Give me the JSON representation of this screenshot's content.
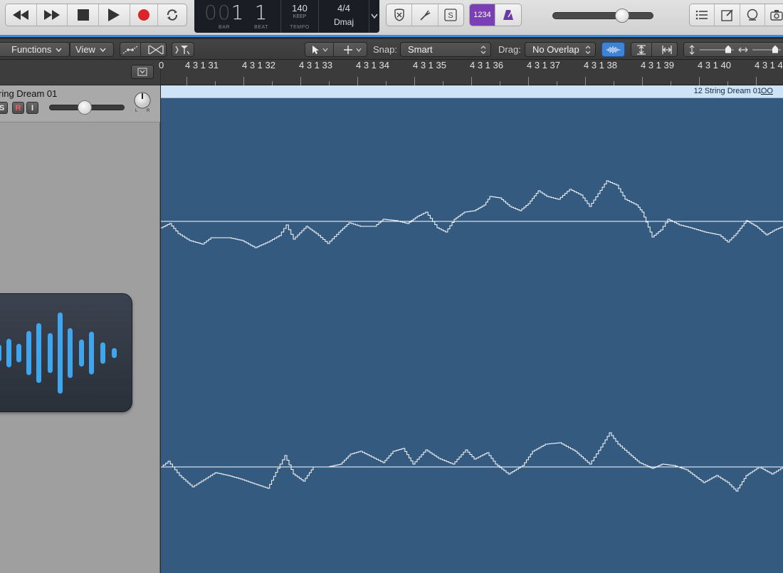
{
  "lcd": {
    "bar_dim": "00",
    "bar": "1",
    "beat": "1",
    "bar_label": "BAR",
    "beat_label": "BEAT",
    "tempo": "140",
    "tempo_mode": "KEEP",
    "tempo_label": "TEMPO",
    "time_signature": "4/4",
    "key": "Dmaj"
  },
  "toolbar": {
    "count_in_label": "1234"
  },
  "editor_toolbar": {
    "functions_label": "Functions",
    "view_label": "View",
    "snap_label": "Snap:",
    "snap_value": "Smart",
    "drag_label": "Drag:",
    "drag_value": "No Overlap"
  },
  "track": {
    "name": "ring Dream 01",
    "solo_label": "S",
    "record_label": "R",
    "input_label": "I",
    "pan_left": "L",
    "pan_right": "R"
  },
  "ruler": {
    "labels": [
      "0",
      "4 3 1 31",
      "4 3 1 32",
      "4 3 1 33",
      "4 3 1 34",
      "4 3 1 35",
      "4 3 1 36",
      "4 3 1 37",
      "4 3 1 38",
      "4 3 1 39",
      "4 3 1 40",
      "4 3 1 4"
    ]
  },
  "region": {
    "name": "12 String Dream 01",
    "loop_symbol": "OO"
  },
  "colors": {
    "editor_bg": "#355a80",
    "waveform": "#ffffff",
    "region_header": "#cfe3f6",
    "accent": "#3a8ee6",
    "record": "#d8262b",
    "count_in": "#7b3fb5"
  }
}
